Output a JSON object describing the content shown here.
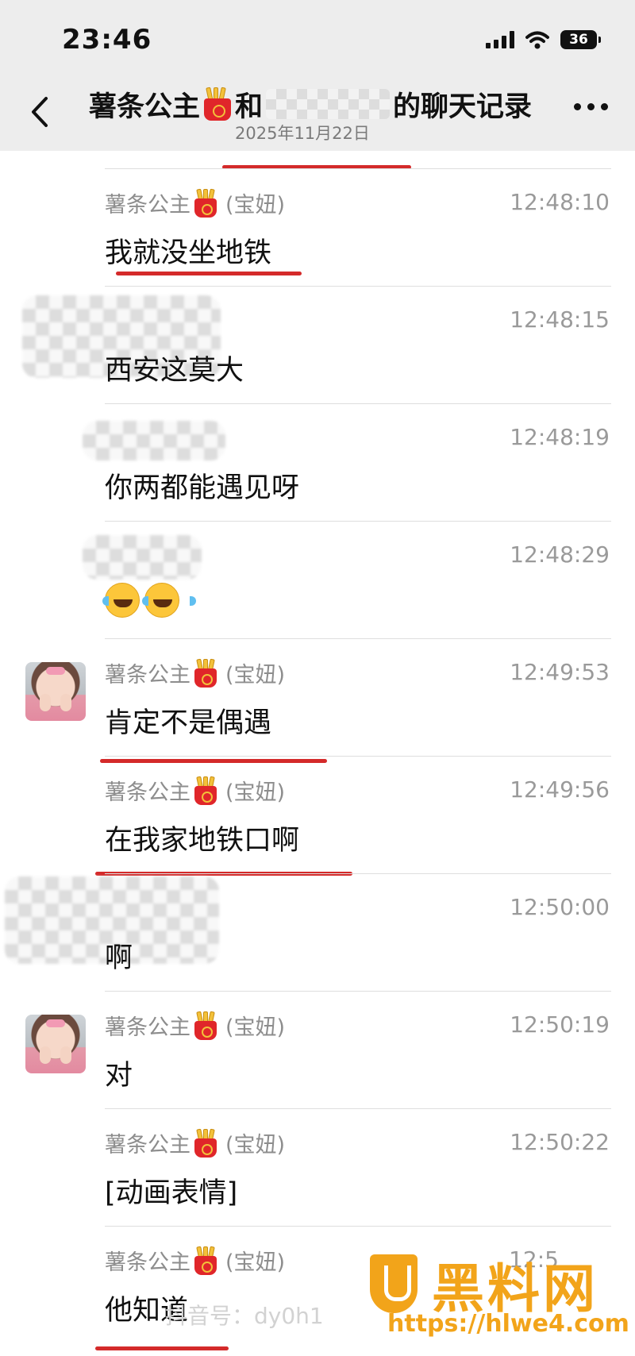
{
  "status_bar": {
    "time": "23:46",
    "battery_level": "36",
    "icons": [
      "signal-icon",
      "wifi-icon",
      "battery-icon"
    ]
  },
  "header": {
    "title_prefix": "薯条公主",
    "title_connector": "和",
    "title_suffix": "的聊天记录",
    "date": "2025年11月22日",
    "back_icon": "chevron-left-icon",
    "more_icon": "more-icon"
  },
  "messages": [
    {
      "sender": "薯条公主",
      "sender_tag": "(宝妞)",
      "time": "12:48:10",
      "text": "我就没坐地铁",
      "has_avatar": false,
      "underlined": true
    },
    {
      "sender": "",
      "sender_tag": "",
      "time": "12:48:15",
      "text": "西安这莫大",
      "has_avatar": false,
      "underlined": false
    },
    {
      "sender": "",
      "sender_tag": "",
      "time": "12:48:19",
      "text": "你两都能遇见呀",
      "has_avatar": false,
      "underlined": false
    },
    {
      "sender": "",
      "sender_tag": "",
      "time": "12:48:29",
      "text": "",
      "emoji": "crying-laughing-emoji x2",
      "has_avatar": false,
      "underlined": false
    },
    {
      "sender": "薯条公主",
      "sender_tag": "(宝妞)",
      "time": "12:49:53",
      "text": "肯定不是偶遇",
      "has_avatar": true,
      "underlined": true
    },
    {
      "sender": "薯条公主",
      "sender_tag": "(宝妞)",
      "time": "12:49:56",
      "text": "在我家地铁口啊",
      "has_avatar": false,
      "underlined": true
    },
    {
      "sender": "",
      "sender_tag": "",
      "time": "12:50:00",
      "text": "啊",
      "has_avatar": false,
      "underlined": false
    },
    {
      "sender": "薯条公主",
      "sender_tag": "(宝妞)",
      "time": "12:50:19",
      "text": "对",
      "has_avatar": true,
      "underlined": false
    },
    {
      "sender": "薯条公主",
      "sender_tag": "(宝妞)",
      "time": "12:50:22",
      "text": "[动画表情]",
      "has_avatar": false,
      "underlined": false
    },
    {
      "sender": "薯条公主",
      "sender_tag": "(宝妞)",
      "time": "12:5",
      "text": "他知道",
      "has_avatar": false,
      "underlined": true
    }
  ],
  "watermarks": {
    "douyin": "抖音号：dy0h1",
    "brand": "黑料网",
    "url": "https://hlwe4.com"
  },
  "colors": {
    "header_bg": "#ededed",
    "underline": "#d42a2a",
    "timestamp": "#9a9a9a",
    "sender": "#8d8d8d",
    "watermark_brand": "#f2a41a"
  }
}
